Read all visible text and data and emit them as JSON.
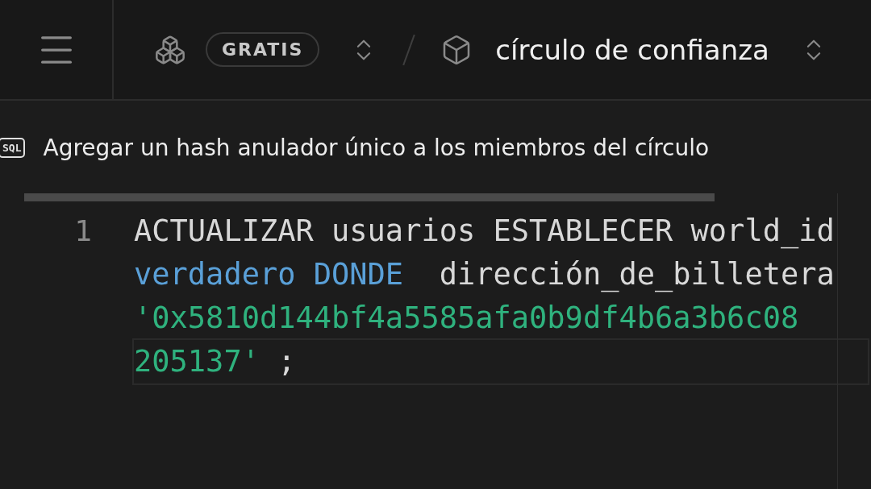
{
  "top_bar": {
    "plan_badge": "GRATIS",
    "project_name": "círculo de confianza"
  },
  "snippet": {
    "badge": "SQL",
    "title": "Agregar un hash anulador único a los miembros del círculo"
  },
  "editor": {
    "line_number": "1",
    "rows": [
      [
        {
          "kind": "plain",
          "text": "ACTUALIZAR usuarios ESTABLECER world_id"
        }
      ],
      [
        {
          "kind": "keyword",
          "text": "verdadero"
        },
        {
          "kind": "plain",
          "text": " "
        },
        {
          "kind": "keyword",
          "text": "DONDE"
        },
        {
          "kind": "plain",
          "text": "  dirección_de_billetera"
        }
      ],
      [
        {
          "kind": "string",
          "text": "'0x5810d144bf4a5585afa0b9df4b6a3b6c08"
        }
      ],
      [
        {
          "kind": "string",
          "text": "205137'"
        },
        {
          "kind": "plain",
          "text": " ;"
        }
      ]
    ]
  }
}
